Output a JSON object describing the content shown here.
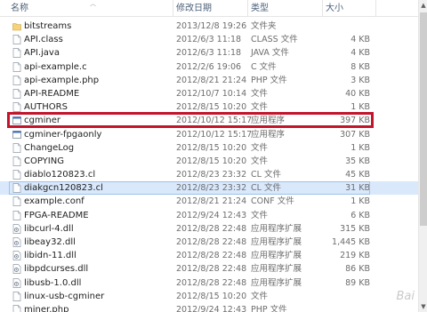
{
  "columns": {
    "name": "名称",
    "date": "修改日期",
    "type": "类型",
    "size": "大小"
  },
  "files": [
    {
      "name": "bitstreams",
      "date": "2013/12/8 19:26",
      "type": "文件夹",
      "size": "",
      "icon": "folder-icon"
    },
    {
      "name": "API.class",
      "date": "2012/6/3 11:18",
      "type": "CLASS 文件",
      "size": "4 KB",
      "icon": "file-icon"
    },
    {
      "name": "API.java",
      "date": "2012/6/3 11:18",
      "type": "JAVA 文件",
      "size": "4 KB",
      "icon": "file-icon"
    },
    {
      "name": "api-example.c",
      "date": "2012/2/6 19:06",
      "type": "C 文件",
      "size": "8 KB",
      "icon": "file-icon"
    },
    {
      "name": "api-example.php",
      "date": "2012/8/21 21:24",
      "type": "PHP 文件",
      "size": "3 KB",
      "icon": "file-icon"
    },
    {
      "name": "API-README",
      "date": "2012/10/7 10:14",
      "type": "文件",
      "size": "40 KB",
      "icon": "file-icon"
    },
    {
      "name": "AUTHORS",
      "date": "2012/8/15 10:20",
      "type": "文件",
      "size": "1 KB",
      "icon": "file-icon"
    },
    {
      "name": "cgminer",
      "date": "2012/10/12 15:17",
      "type": "应用程序",
      "size": "397 KB",
      "icon": "exe-icon"
    },
    {
      "name": "cgminer-fpgaonly",
      "date": "2012/10/12 15:17",
      "type": "应用程序",
      "size": "307 KB",
      "icon": "exe-icon"
    },
    {
      "name": "ChangeLog",
      "date": "2012/8/15 10:20",
      "type": "文件",
      "size": "1 KB",
      "icon": "file-icon"
    },
    {
      "name": "COPYING",
      "date": "2012/8/15 10:20",
      "type": "文件",
      "size": "35 KB",
      "icon": "file-icon"
    },
    {
      "name": "diablo120823.cl",
      "date": "2012/8/23 23:32",
      "type": "CL 文件",
      "size": "45 KB",
      "icon": "file-icon"
    },
    {
      "name": "diakgcn120823.cl",
      "date": "2012/8/23 23:32",
      "type": "CL 文件",
      "size": "31 KB",
      "icon": "file-icon",
      "selected": true
    },
    {
      "name": "example.conf",
      "date": "2012/8/21 21:24",
      "type": "CONF 文件",
      "size": "1 KB",
      "icon": "file-icon"
    },
    {
      "name": "FPGA-README",
      "date": "2012/9/24 12:43",
      "type": "文件",
      "size": "6 KB",
      "icon": "file-icon"
    },
    {
      "name": "libcurl-4.dll",
      "date": "2012/8/28 22:48",
      "type": "应用程序扩展",
      "size": "315 KB",
      "icon": "dll-icon"
    },
    {
      "name": "libeay32.dll",
      "date": "2012/8/28 22:48",
      "type": "应用程序扩展",
      "size": "1,445 KB",
      "icon": "dll-icon"
    },
    {
      "name": "libidn-11.dll",
      "date": "2012/8/28 22:48",
      "type": "应用程序扩展",
      "size": "219 KB",
      "icon": "dll-icon"
    },
    {
      "name": "libpdcurses.dll",
      "date": "2012/8/28 22:48",
      "type": "应用程序扩展",
      "size": "86 KB",
      "icon": "dll-icon"
    },
    {
      "name": "libusb-1.0.dll",
      "date": "2012/8/28 22:48",
      "type": "应用程序扩展",
      "size": "89 KB",
      "icon": "dll-icon"
    },
    {
      "name": "linux-usb-cgminer",
      "date": "2012/8/15 10:20",
      "type": "文件",
      "size": "",
      "icon": "file-icon"
    },
    {
      "name": "miner.php",
      "date": "2012/9/24 12:43",
      "type": "PHP 文件",
      "size": "",
      "icon": "file-icon"
    }
  ],
  "watermark": "Bai",
  "colors": {
    "highlight_box": "#c2152b",
    "selection": "#d9e8fb",
    "header_text": "#4c607a"
  }
}
